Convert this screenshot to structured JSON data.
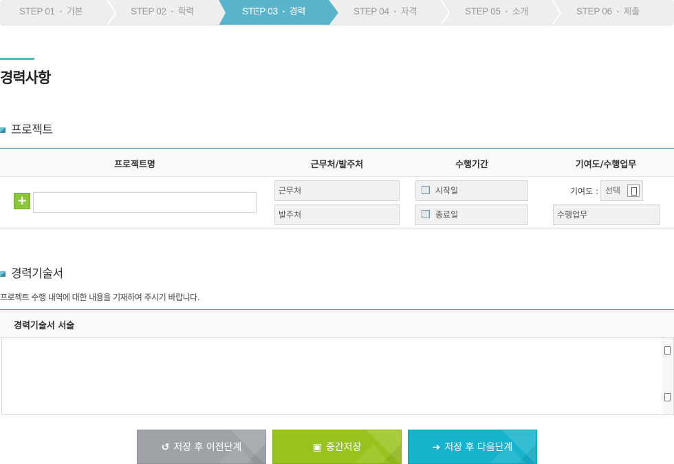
{
  "steps": [
    {
      "num": "STEP 01",
      "label": "기본"
    },
    {
      "num": "STEP 02",
      "label": "학력"
    },
    {
      "num": "STEP 03",
      "label": "경력"
    },
    {
      "num": "STEP 04",
      "label": "자격"
    },
    {
      "num": "STEP 05",
      "label": "소개"
    },
    {
      "num": "STEP 06",
      "label": "제출"
    }
  ],
  "page_title": "경력사항",
  "project": {
    "section_title": "프로젝트",
    "headers": [
      "프로젝트명",
      "근무처/발주처",
      "수행기간",
      "기여도/수행업무"
    ],
    "add_symbol": "+",
    "workplace_placeholder": "근무처",
    "client_placeholder": "발주처",
    "start_placeholder": "시작일",
    "end_placeholder": "종료일",
    "contribution_label": "기여도 :",
    "contribution_value": "선택",
    "duty_placeholder": "수행업무"
  },
  "career": {
    "section_title": "경력기술서",
    "description": "프로젝트 수행 내역에 대한 내용을 기재하여 주시기 바랍니다.",
    "field_label": "경력기술서 서술"
  },
  "buttons": {
    "prev": "저장 후 이전단계",
    "mid": "중간저장",
    "next": "저장 후 다음단계"
  },
  "colors": {
    "active_step": "#5ab4cc",
    "accent_line": "#4aa9b9",
    "prev_button": "#9ea1a5",
    "mid_button": "#98c31c",
    "next_button": "#17b3cc",
    "add_button": "#8cc63f"
  },
  "icons": {
    "prev": "undo-icon",
    "mid": "save-icon",
    "next": "arrow-right-icon",
    "date": "calendar-icon"
  }
}
